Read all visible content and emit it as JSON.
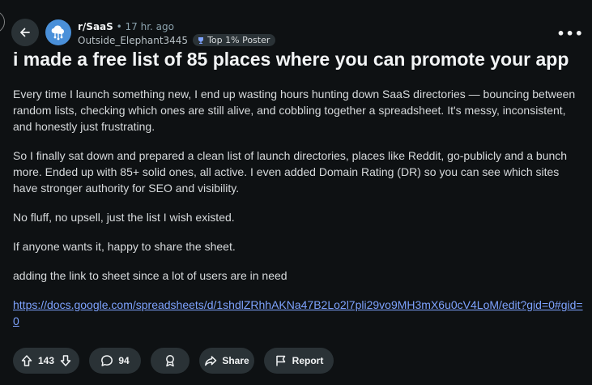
{
  "post": {
    "subreddit": "r/SaaS",
    "separator": "•",
    "time": "17 hr. ago",
    "author": "Outside_Elephant3445",
    "flair": "Top 1% Poster",
    "title": "i made a free list of 85 places where you can promote your app",
    "body": {
      "p1": "Every time I launch something new, I end up wasting hours hunting down SaaS directories — bouncing between random lists, checking which ones are still alive, and cobbling together a spreadsheet. It's messy, inconsistent, and honestly just frustrating.",
      "p2": "So I finally sat down and prepared a clean list of launch directories, places like Reddit, go-publicly and a bunch more. Ended up with 85+ solid ones, all active. I even added Domain Rating (DR) so you can see which sites have stronger authority for SEO and visibility.",
      "p3": "No fluff, no upsell, just the list I wish existed.",
      "p4": "If anyone wants it, happy to share the sheet.",
      "p5": "adding the link to sheet since a lot of users are in need",
      "link": "https://docs.google.com/spreadsheets/d/1shdlZRhhAKNa47B2Lo2l7pli29vo9MH3mX6u0cV4LoM/edit?gid=0#gid=0"
    }
  },
  "actions": {
    "upvote_count": "143",
    "comment_count": "94",
    "share_label": "Share",
    "report_label": "Report"
  },
  "icons": {
    "back": "arrow-left-icon",
    "more": "more-horizontal-icon",
    "upvote": "arrow-up-icon",
    "downvote": "arrow-down-icon",
    "comment": "speech-bubble-icon",
    "award": "award-icon",
    "share": "share-arrow-icon",
    "report": "flag-icon"
  },
  "colors": {
    "background": "#0e1113",
    "pill": "#2a3236",
    "link": "#7ea3ff",
    "avatar": "#4a90d9"
  }
}
